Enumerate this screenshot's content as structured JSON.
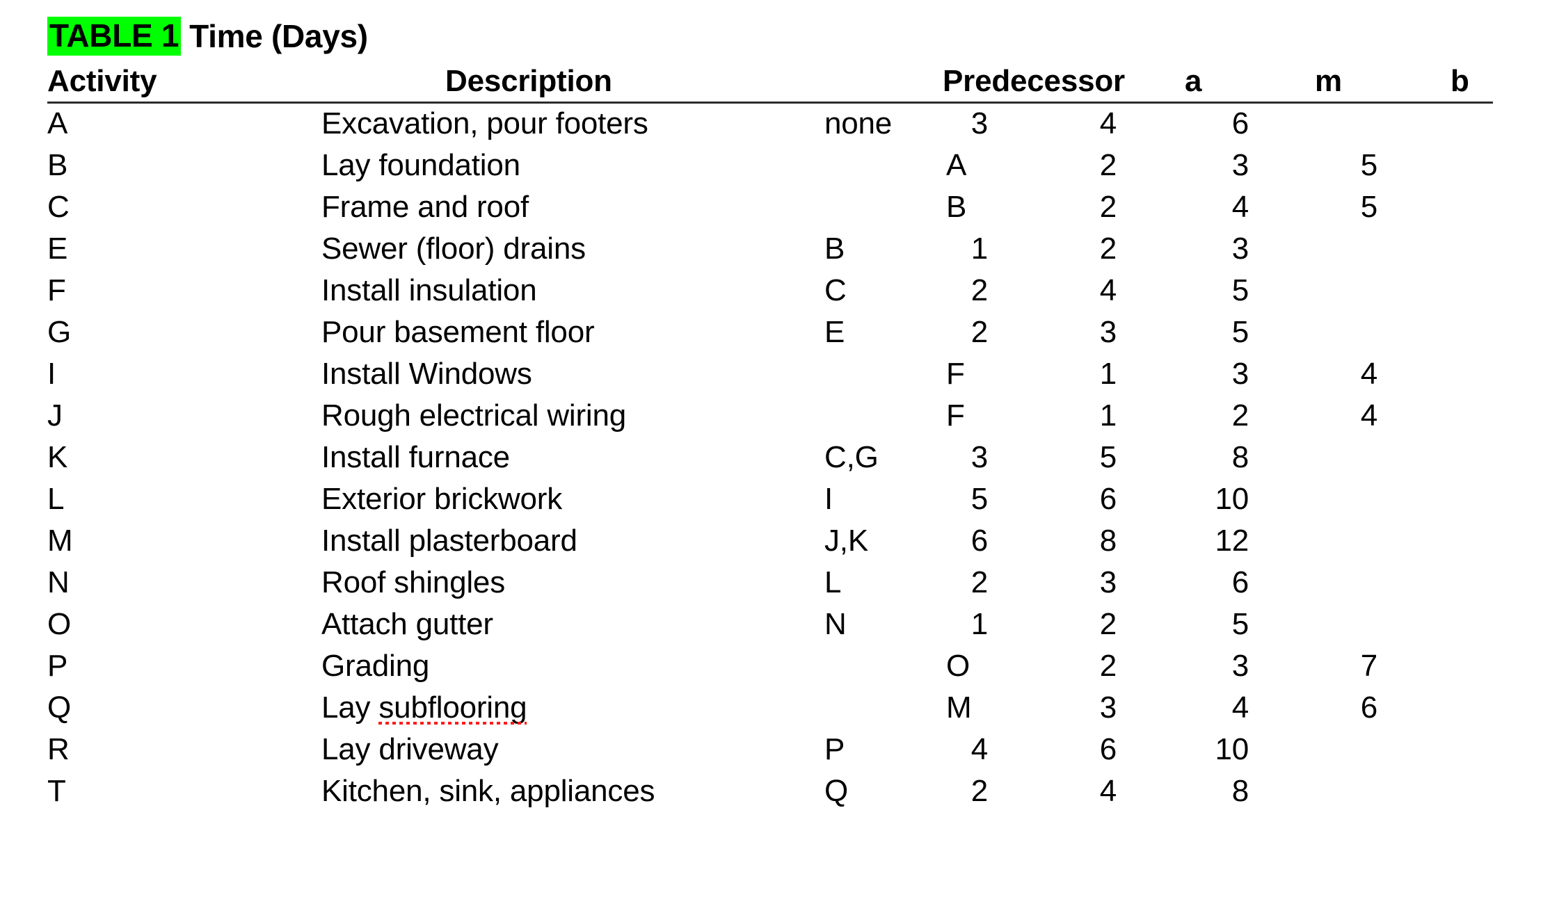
{
  "document": {
    "title_badge": "TABLE 1",
    "title_rest": "Time (Days)",
    "highlight_color": "#00FF00",
    "text_color": "#000000",
    "background_color": "#FFFFFF",
    "spellcheck_underline_color": "#FF1A1A"
  },
  "table": {
    "headers": {
      "activity": "Activity",
      "description": "Description",
      "predecessor": "Predecessor",
      "a": "a",
      "m": "m",
      "b": "b"
    },
    "rows": [
      {
        "activity": "A",
        "description": "Excavation, pour footers",
        "predecessor": "none",
        "pred_align": "left",
        "a": "3",
        "m": "4",
        "b": "6",
        "a_shift": true,
        "misspelled": false
      },
      {
        "activity": "B",
        "description": "Lay foundation",
        "predecessor": "A",
        "pred_align": "right",
        "a": "2",
        "m": "3",
        "b": "5",
        "a_shift": false,
        "misspelled": false
      },
      {
        "activity": "C",
        "description": "Frame and roof",
        "predecessor": "B",
        "pred_align": "right",
        "a": "2",
        "m": "4",
        "b": "5",
        "a_shift": false,
        "misspelled": false
      },
      {
        "activity": "E",
        "description": "Sewer (floor) drains",
        "predecessor": "B",
        "pred_align": "left",
        "a": "1",
        "m": "2",
        "b": "3",
        "a_shift": true,
        "misspelled": false
      },
      {
        "activity": "F",
        "description": "Install insulation",
        "predecessor": "C",
        "pred_align": "left",
        "a": "2",
        "m": "4",
        "b": "5",
        "a_shift": true,
        "misspelled": false
      },
      {
        "activity": "G",
        "description": "Pour basement floor",
        "predecessor": "E",
        "pred_align": "left",
        "a": "2",
        "m": "3",
        "b": "5",
        "a_shift": true,
        "misspelled": false
      },
      {
        "activity": "I",
        "description": "Install Windows",
        "predecessor": "F",
        "pred_align": "right",
        "a": "1",
        "m": "3",
        "b": "4",
        "a_shift": false,
        "misspelled": false
      },
      {
        "activity": "J",
        "description": "Rough electrical wiring",
        "predecessor": "F",
        "pred_align": "right",
        "a": "1",
        "m": "2",
        "b": "4",
        "a_shift": false,
        "misspelled": false
      },
      {
        "activity": "K",
        "description": "Install furnace",
        "predecessor": "C,G",
        "pred_align": "left",
        "a": "3",
        "m": "5",
        "b": "8",
        "a_shift": true,
        "misspelled": false
      },
      {
        "activity": "L",
        "description": "Exterior brickwork",
        "predecessor": "I",
        "pred_align": "left",
        "a": "5",
        "m": "6",
        "b": "10",
        "a_shift": true,
        "misspelled": false
      },
      {
        "activity": "M",
        "description": "Install plasterboard",
        "predecessor": "J,K",
        "pred_align": "left",
        "a": "6",
        "m": "8",
        "b": "12",
        "a_shift": true,
        "misspelled": false
      },
      {
        "activity": "N",
        "description": "Roof shingles",
        "predecessor": "L",
        "pred_align": "left",
        "a": "2",
        "m": "3",
        "b": "6",
        "a_shift": true,
        "misspelled": false
      },
      {
        "activity": "O",
        "description": "Attach gutter",
        "predecessor": "N",
        "pred_align": "left",
        "a": "1",
        "m": "2",
        "b": "5",
        "a_shift": true,
        "misspelled": false
      },
      {
        "activity": "P",
        "description": "Grading",
        "predecessor": "O",
        "pred_align": "right",
        "a": "2",
        "m": "3",
        "b": "7",
        "a_shift": false,
        "misspelled": false
      },
      {
        "activity": "Q",
        "description": "Lay subflooring",
        "predecessor": "M",
        "pred_align": "right",
        "a": "3",
        "m": "4",
        "b": "6",
        "a_shift": false,
        "misspelled": true,
        "misspelled_word": "subflooring",
        "prefix": "Lay "
      },
      {
        "activity": "R",
        "description": "Lay driveway",
        "predecessor": "P",
        "pred_align": "left",
        "a": "4",
        "m": "6",
        "b": "10",
        "a_shift": true,
        "misspelled": false
      },
      {
        "activity": "T",
        "description": "Kitchen, sink, appliances",
        "predecessor": "Q",
        "pred_align": "left",
        "a": "2",
        "m": "4",
        "b": "8",
        "a_shift": true,
        "misspelled": false
      }
    ]
  }
}
